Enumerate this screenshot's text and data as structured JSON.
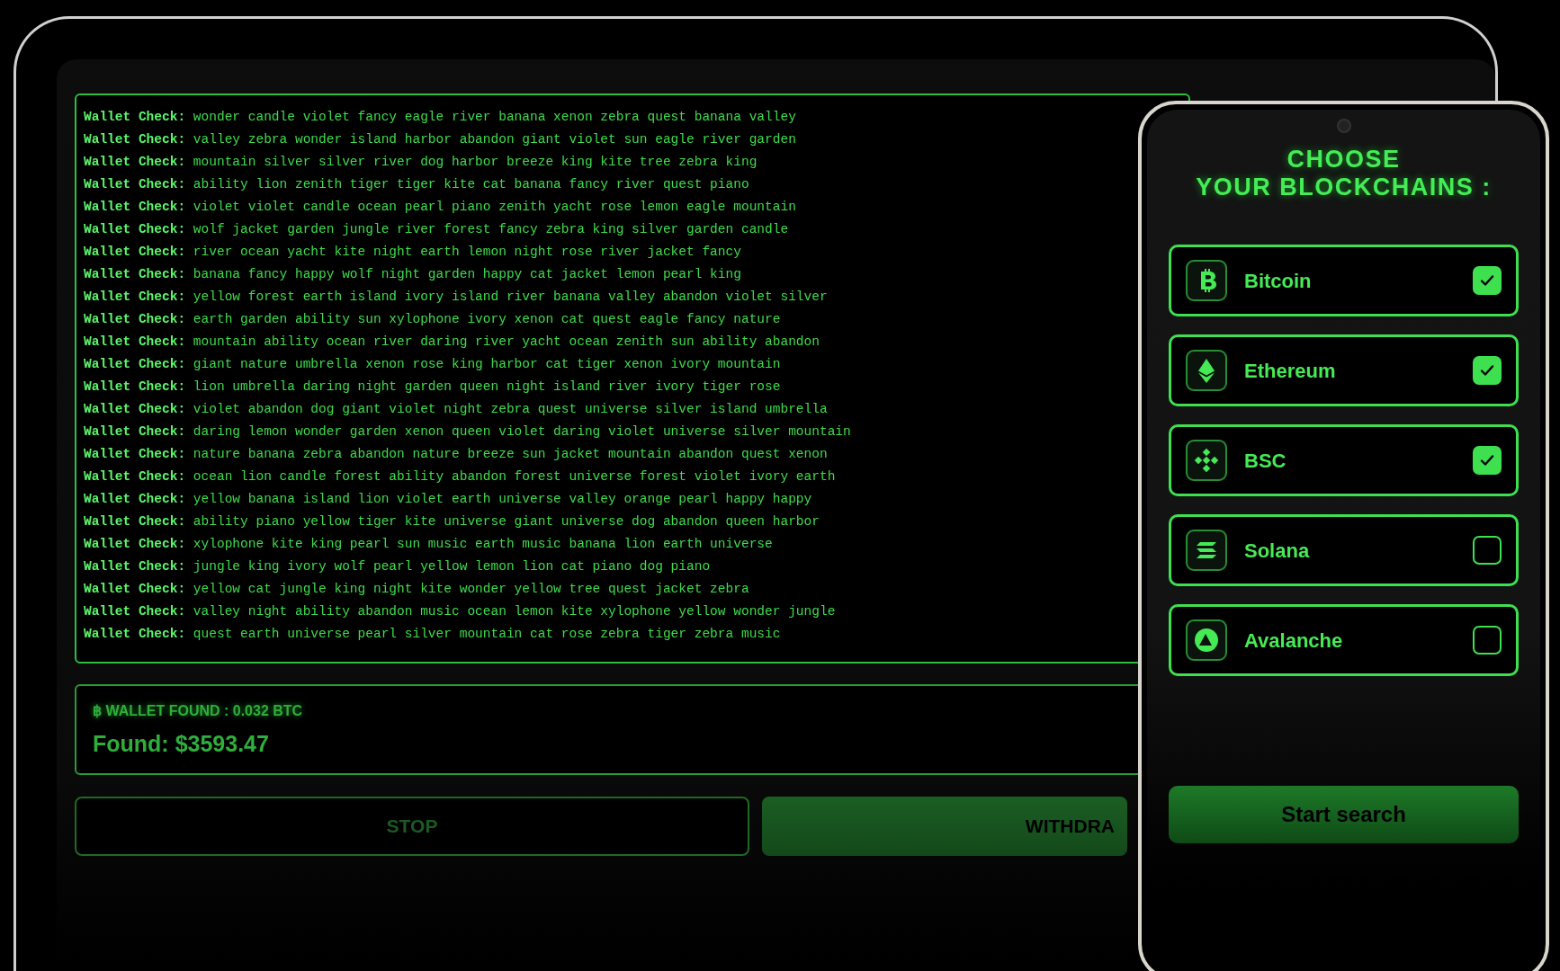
{
  "tablet": {
    "log": [
      "**Wallet Check:** wonder candle violet fancy eagle river banana xenon zebra quest banana valley",
      "**Wallet Check:** valley zebra wonder island harbor abandon giant violet sun eagle river garden",
      "**Wallet Check:** mountain silver silver river dog harbor breeze king kite tree zebra king",
      "**Wallet Check:** ability lion zenith tiger tiger kite cat banana fancy river quest piano",
      "**Wallet Check:** violet violet candle ocean pearl piano zenith yacht rose lemon eagle mountain",
      "**Wallet Check:** wolf jacket garden jungle river forest fancy zebra king silver garden candle",
      "**Wallet Check:** river ocean yacht kite night earth lemon night rose river jacket fancy",
      "**Wallet Check:** banana fancy happy wolf night garden happy cat jacket lemon pearl king",
      "**Wallet Check:** yellow forest earth island ivory island river banana valley abandon violet silver",
      "**Wallet Check:** earth garden ability sun xylophone ivory xenon cat quest eagle fancy nature",
      "**Wallet Check:** mountain ability ocean river daring river yacht ocean zenith sun ability abandon",
      "**Wallet Check:** giant nature umbrella xenon rose king harbor cat tiger xenon ivory mountain",
      "**Wallet Check:** lion umbrella daring night garden queen night island river ivory tiger rose",
      "**Wallet Check:** violet abandon dog giant violet night zebra quest universe silver island umbrella",
      "**Wallet Check:** daring lemon wonder garden xenon queen violet daring violet universe silver mountain",
      "**Wallet Check:** nature banana zebra abandon nature breeze sun jacket mountain abandon quest xenon",
      "**Wallet Check:** ocean lion candle forest ability abandon forest universe forest violet ivory earth",
      "**Wallet Check:** yellow banana island lion violet earth universe valley orange pearl happy happy",
      "**Wallet Check:** ability piano yellow tiger kite universe giant universe dog abandon queen harbor",
      "**Wallet Check:** xylophone kite king pearl sun music earth music banana lion earth universe",
      "**Wallet Check:** jungle king ivory wolf pearl yellow lemon lion cat piano dog piano",
      "**Wallet Check:** yellow cat jungle king night kite wonder yellow tree quest jacket zebra",
      "**Wallet Check:** valley night ability abandon music ocean lemon kite xylophone yellow wonder jungle",
      "**Wallet Check:** quest earth universe pearl silver mountain cat rose zebra tiger zebra music"
    ],
    "found": {
      "notice": "฿ WALLET FOUND : 0.032 BTC",
      "amount": "Found: $3593.47"
    },
    "buttons": [
      {
        "label": "STOP",
        "kind": "outline"
      },
      {
        "label": "WITHDRA",
        "kind": "filled"
      }
    ]
  },
  "phone": {
    "title": "CHOOSE\nYOUR BLOCKCHAINS :",
    "chains": [
      {
        "name": "Bitcoin",
        "checked": true
      },
      {
        "name": "Ethereum",
        "checked": true
      },
      {
        "name": "BSC",
        "checked": true
      },
      {
        "name": "Solana",
        "checked": false
      },
      {
        "name": "Avalanche",
        "checked": false
      }
    ],
    "button": "Start search"
  }
}
